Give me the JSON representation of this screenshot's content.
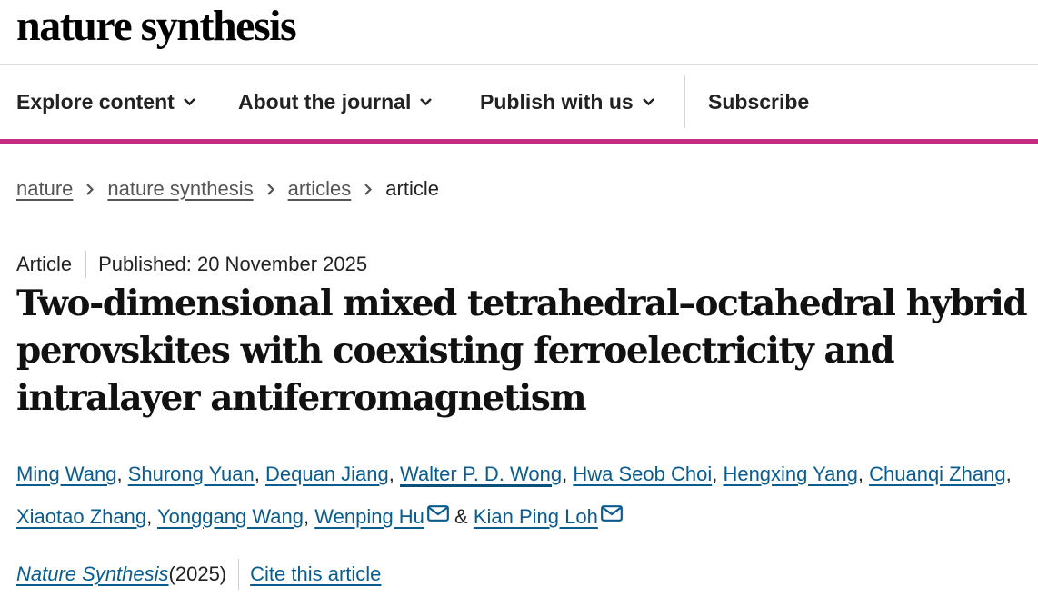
{
  "header": {
    "logo_text": "nature synthesis"
  },
  "nav": {
    "explore": "Explore content",
    "about": "About the journal",
    "publish": "Publish with us",
    "subscribe": "Subscribe"
  },
  "colors": {
    "accent": "#c42e82",
    "link": "#0a5c8f",
    "text": "#222222"
  },
  "breadcrumb": {
    "items": [
      {
        "label": "nature"
      },
      {
        "label": "nature synthesis"
      },
      {
        "label": "articles"
      }
    ],
    "current": "article"
  },
  "article": {
    "type": "Article",
    "published": "Published: 20 November 2025",
    "title": "Two-dimensional mixed tetrahedral–octahedral hybrid perovskites with coexisting ferroelectricity and intralayer antiferromagnetism",
    "authors": [
      "Ming Wang",
      "Shurong Yuan",
      "Dequan Jiang",
      "Walter P. D. Wong",
      "Hwa Seob Choi",
      "Hengxing Yang",
      "Chuanqi Zhang",
      "Xiaotao Zhang",
      "Yonggang Wang",
      "Wenping Hu",
      "Kian Ping Loh"
    ],
    "separators": {
      "comma": ", ",
      "amp": " & "
    },
    "journal": "Nature Synthesis",
    "year": " (2025)",
    "cite": "Cite this article"
  },
  "icons": {
    "chevron": "chevron-down-icon",
    "crumb": "chevron-right-icon",
    "mail": "mail-icon"
  }
}
